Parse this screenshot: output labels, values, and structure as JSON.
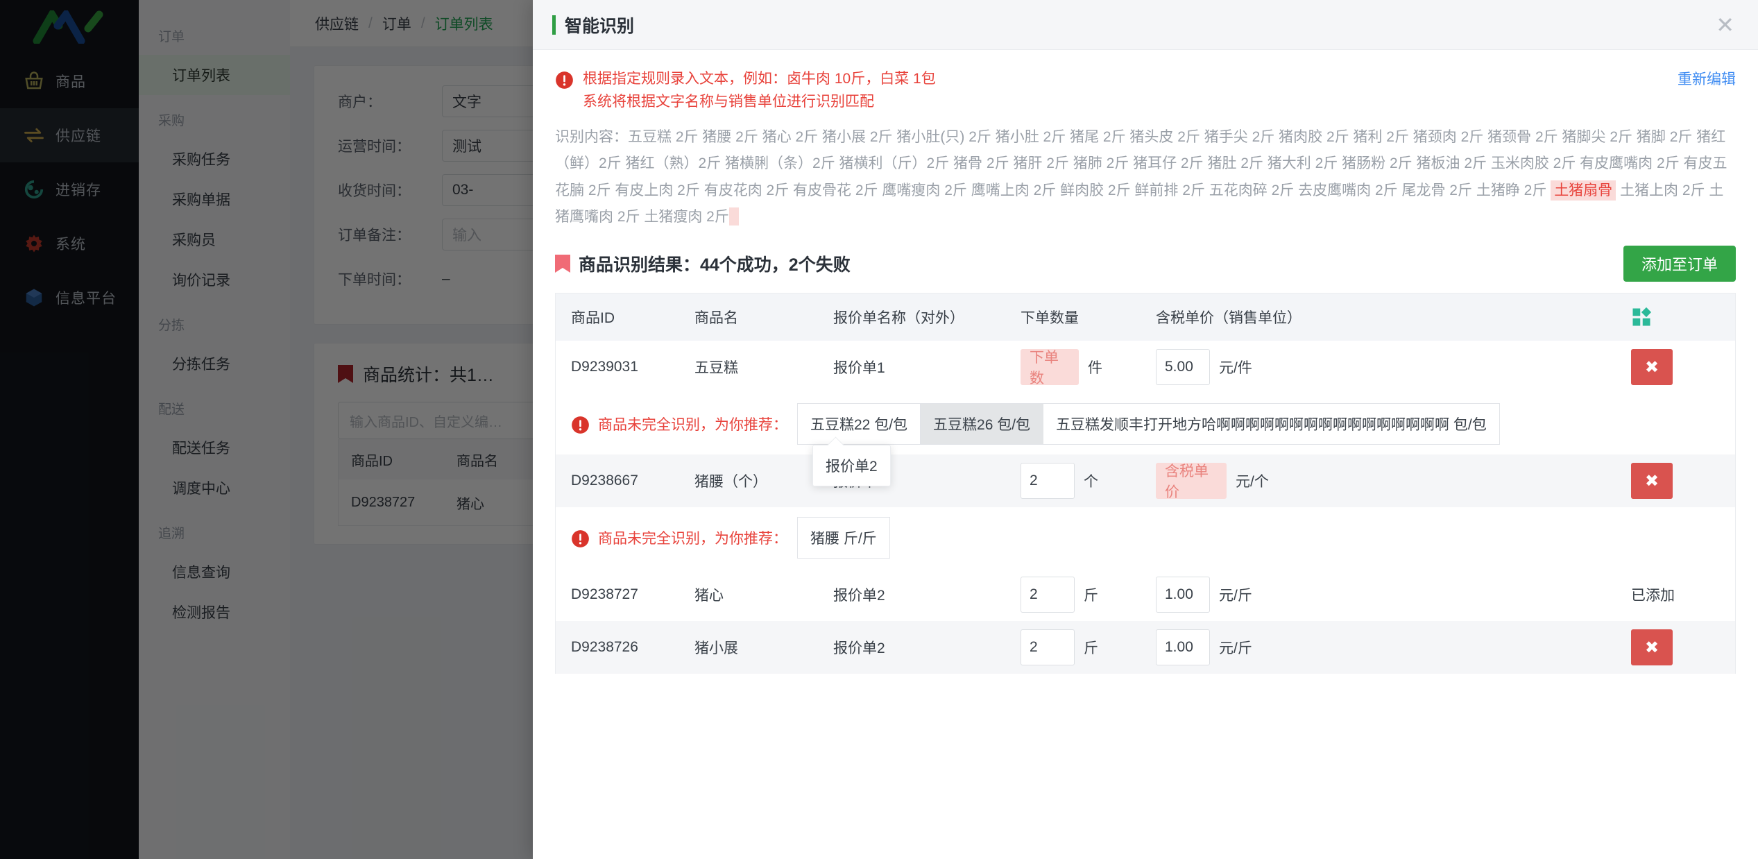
{
  "sidebar": {
    "logo_name": "app-logo",
    "items": [
      {
        "label": "商品",
        "icon": "basket-icon",
        "active": false
      },
      {
        "label": "供应链",
        "icon": "exchange-arrows-icon",
        "active": true
      },
      {
        "label": "进销存",
        "icon": "inventory-icon",
        "active": false
      },
      {
        "label": "系统",
        "icon": "gear-icon",
        "active": false
      },
      {
        "label": "信息平台",
        "icon": "box-icon",
        "active": false
      }
    ]
  },
  "submenu": {
    "groups": [
      {
        "title": "订单",
        "items": [
          {
            "label": "订单列表",
            "active": true
          }
        ]
      },
      {
        "title": "采购",
        "items": [
          {
            "label": "采购任务",
            "active": false
          },
          {
            "label": "采购单据",
            "active": false
          },
          {
            "label": "采购员",
            "active": false
          },
          {
            "label": "询价记录",
            "active": false
          }
        ]
      },
      {
        "title": "分拣",
        "items": [
          {
            "label": "分拣任务",
            "active": false
          }
        ]
      },
      {
        "title": "配送",
        "items": [
          {
            "label": "配送任务",
            "active": false
          },
          {
            "label": "调度中心",
            "active": false
          }
        ]
      },
      {
        "title": "追溯",
        "items": [
          {
            "label": "信息查询",
            "active": false
          },
          {
            "label": "检测报告",
            "active": false
          }
        ]
      }
    ]
  },
  "breadcrumb": {
    "items": [
      "供应链",
      "订单",
      "订单列表"
    ],
    "separator": "/"
  },
  "bg_form": {
    "rows": [
      {
        "label": "商户：",
        "value": "文字",
        "type": "input"
      },
      {
        "label": "运营时间：",
        "value": "测试",
        "type": "input"
      },
      {
        "label": "收货时间：",
        "value": "03-",
        "type": "input"
      },
      {
        "label": "订单备注：",
        "value": "输入",
        "type": "placeholder"
      },
      {
        "label": "下单时间：",
        "value": "–",
        "type": "plain"
      }
    ]
  },
  "bg_stats": {
    "title": "商品统计：共1…",
    "search_placeholder": "输入商品ID、自定义编…",
    "columns": [
      "商品ID",
      "商品名"
    ],
    "rows": [
      {
        "id": "D9238727",
        "name": "猪心"
      }
    ]
  },
  "modal": {
    "title": "智能识别",
    "close_icon": "close-icon",
    "tip": {
      "icon": "warning-circle-icon",
      "line1": "根据指定规则录入文本，例如：卤牛肉 10斤，白菜 1包",
      "line2": "系统将根据文字名称与销售单位进行识别匹配",
      "edit_link": "重新编辑"
    },
    "recognized": {
      "label": "识别内容：",
      "text": "五豆糕 2斤 猪腰 2斤 猪心 2斤 猪小展 2斤 猪小肚(只) 2斤 猪小肚 2斤 猪尾 2斤 猪头皮 2斤 猪手尖 2斤 猪肉胶 2斤 猪利 2斤 猪颈肉 2斤 猪颈骨 2斤 猪脚尖 2斤 猪脚 2斤 猪红（鲜）2斤 猪红（熟）2斤 猪横脷（条）2斤 猪横利（斤）2斤 猪骨 2斤 猪肝 2斤 猪肺 2斤 猪耳仔 2斤 猪肚 2斤 猪大利 2斤 猪肠粉 2斤 猪板油 2斤 玉米肉胶 2斤 有皮鹰嘴肉 2斤 有皮五花腩 2斤 有皮上肉 2斤 有皮花肉 2斤 有皮骨花 2斤 鹰嘴瘦肉 2斤 鹰嘴上肉 2斤 鲜肉胶 2斤 鲜前排 2斤 五花肉碎 2斤 去皮鹰嘴肉 2斤 尾龙骨 2斤 土猪睁 2斤 ",
      "highlight": "土猪扇骨",
      "text_after": " 土猪上肉 2斤 土猪鹰嘴肉 2斤 土猪瘦肉 2斤"
    },
    "result": {
      "icon": "tag-icon",
      "title": "商品识别结果：44个成功，2个失败",
      "add_button": "添加至订单"
    },
    "table": {
      "columns": [
        "商品ID",
        "商品名",
        "报价单名称（对外）",
        "下单数量",
        "含税单价（销售单位）"
      ],
      "settings_icon": "grid-settings-icon",
      "rows": [
        {
          "id": "D9239031",
          "name": "五豆糕",
          "quote": "报价单1",
          "qty": "下单数",
          "qty_error": true,
          "qty_unit": "件",
          "price": "5.00",
          "price_error": false,
          "price_unit": "元/件",
          "action": "delete",
          "action_label": "✖"
        },
        {
          "id": "D9238667",
          "name": "猪腰（个）",
          "quote": "报价单2",
          "qty": "2",
          "qty_error": false,
          "qty_unit": "个",
          "price": "含税单价",
          "price_error": true,
          "price_unit": "元/个",
          "action": "delete",
          "action_label": "✖"
        },
        {
          "id": "D9238727",
          "name": "猪心",
          "quote": "报价单2",
          "qty": "2",
          "qty_error": false,
          "qty_unit": "斤",
          "price": "1.00",
          "price_error": false,
          "price_unit": "元/斤",
          "action": "added",
          "action_label": "已添加"
        },
        {
          "id": "D9238726",
          "name": "猪小展",
          "quote": "报价单2",
          "qty": "2",
          "qty_error": false,
          "qty_unit": "斤",
          "price": "1.00",
          "price_error": false,
          "price_unit": "元/斤",
          "action": "delete",
          "action_label": "✖"
        }
      ],
      "recommendations": [
        {
          "after_row": 0,
          "icon": "warning-circle-icon",
          "label": "商品未完全识别，为你推荐：",
          "chips": [
            {
              "text": "五豆糕22 包/包",
              "selected": false
            },
            {
              "text": "五豆糕26 包/包",
              "selected": true
            },
            {
              "text": "五豆糕发顺丰打开地方哈啊啊啊啊啊啊啊啊啊啊啊啊啊啊啊啊 包/包",
              "selected": false
            }
          ]
        },
        {
          "after_row": 1,
          "icon": "warning-circle-icon",
          "label": "商品未完全识别，为你推荐：",
          "chips": [
            {
              "text": "猪腰 斤/斤",
              "selected": false
            }
          ]
        }
      ]
    },
    "popover": {
      "text": "报价单2"
    }
  },
  "colors": {
    "brand_green": "#33a547",
    "accent_green": "#2f9e44",
    "danger_red": "#e8433c",
    "delete_red": "#d9534f",
    "link_blue": "#3f8cf2",
    "teal": "#2bb999",
    "error_bg": "#fadbd9"
  }
}
